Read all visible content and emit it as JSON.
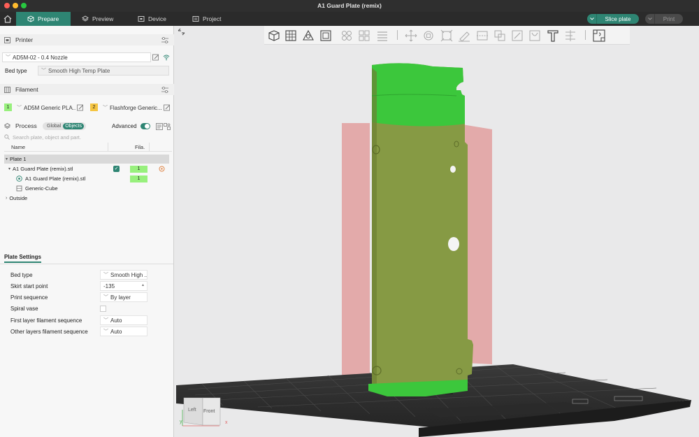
{
  "window": {
    "title": "A1 Guard Plate (remix)"
  },
  "nav": {
    "tabs": [
      {
        "label": "Prepare",
        "active": true
      },
      {
        "label": "Preview",
        "active": false
      },
      {
        "label": "Device",
        "active": false
      },
      {
        "label": "Project",
        "active": false
      }
    ],
    "slice_label": "Slice plate",
    "print_label": "Print"
  },
  "printer": {
    "section_label": "Printer",
    "name": "AD5M-02 - 0.4 Nozzle",
    "bed_type_label": "Bed type",
    "bed_type_value": "Smooth High Temp Plate"
  },
  "filament": {
    "section_label": "Filament",
    "slots": [
      {
        "index": "1",
        "name": "AD5M Generic PLA...",
        "color": "#98f07d"
      },
      {
        "index": "2",
        "name": "Flashforge Generic...",
        "color": "#f5c542"
      }
    ]
  },
  "process": {
    "section_label": "Process",
    "toggle_global": "Global",
    "toggle_objects": "Objects",
    "advanced_label": "Advanced",
    "search_placeholder": "Search plate, object and part."
  },
  "tree": {
    "col_name": "Name",
    "col_fila": "Fila.",
    "plate": "Plate 1",
    "object": {
      "name": "A1 Guard Plate (remix).stl",
      "fila": "1"
    },
    "part": {
      "name": "A1 Guard Plate (remix).stl",
      "fila": "1"
    },
    "modifier": "Generic-Cube",
    "outside": "Outside"
  },
  "plate_settings": {
    "tab_label": "Plate Settings",
    "rows": [
      {
        "label": "Bed type",
        "value": "Smooth High ..."
      },
      {
        "label": "Skirt start point",
        "value": "-135"
      },
      {
        "label": "Print sequence",
        "value": "By layer"
      },
      {
        "label": "Spiral vase",
        "value": ""
      },
      {
        "label": "First layer filament sequence",
        "value": "Auto"
      },
      {
        "label": "Other layers filament sequence",
        "value": "Auto"
      }
    ]
  },
  "viewport": {
    "view_cube_left": "Left",
    "view_cube_front": "Front",
    "axis_x": "x",
    "axis_y": "y"
  },
  "colors": {
    "accent": "#2e8573",
    "model_green": "#3cc73c",
    "bed": "#2c2c2c",
    "boundary": "#e89a9a"
  }
}
